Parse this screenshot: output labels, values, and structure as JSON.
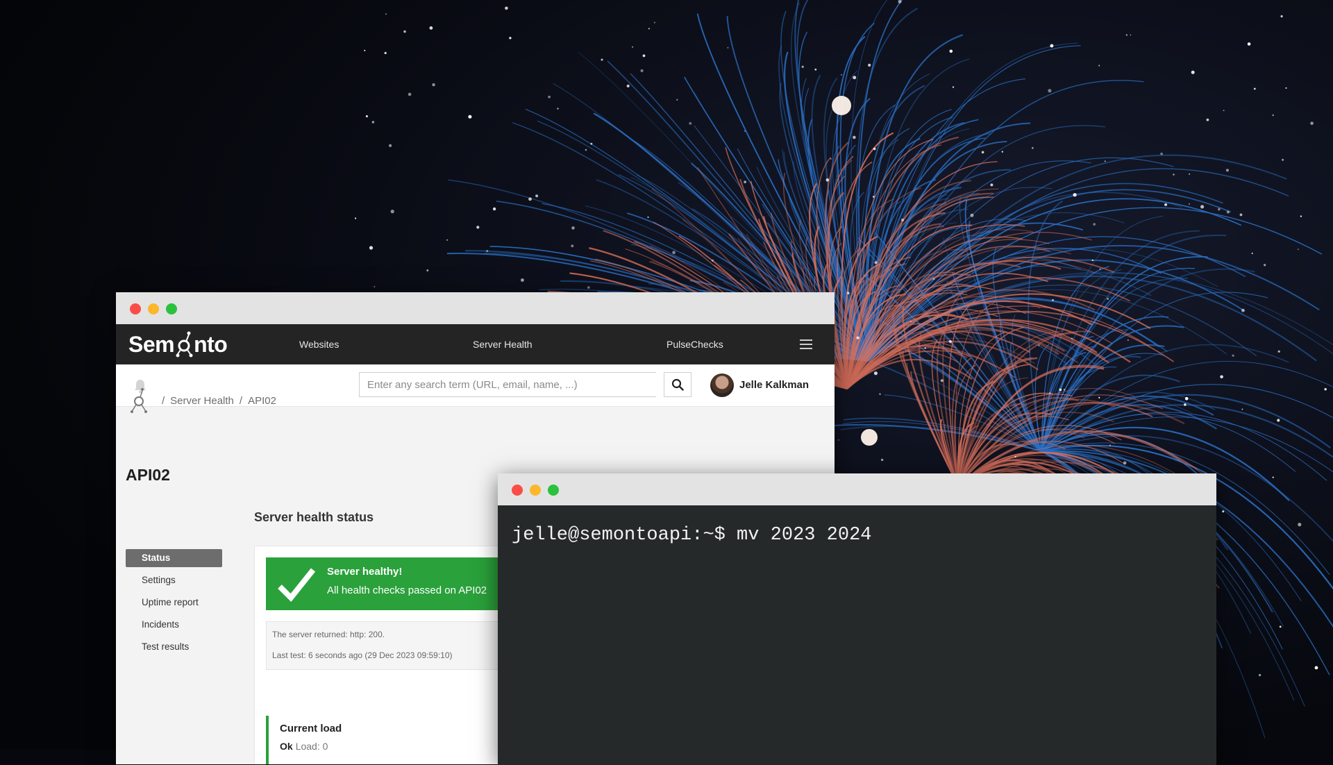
{
  "colors": {
    "accent_green": "#2aa13b",
    "navbar_bg": "#242424",
    "terminal_bg": "#262929",
    "traffic_red": "#fc4c48",
    "traffic_yellow": "#fcb72c",
    "traffic_green": "#2ac23d"
  },
  "browser": {
    "navbar": {
      "logo_left": "Sem",
      "logo_right": "nto",
      "links": [
        "Websites",
        "Server Health",
        "PulseChecks"
      ]
    },
    "search": {
      "placeholder": "Enter any search term (URL, email, name, ...)"
    },
    "user": {
      "name": "Jelle Kalkman"
    },
    "breadcrumb": {
      "items": [
        "Server Health",
        "API02"
      ]
    },
    "page_title": "API02",
    "section_title": "Server health status",
    "side_menu": {
      "items": [
        "Status",
        "Settings",
        "Uptime report",
        "Incidents",
        "Test results"
      ],
      "active": "Status"
    },
    "status": {
      "title": "Server healthy!",
      "description": "All health checks passed on API02",
      "returned": "The server returned: http: 200.",
      "last_test": "Last test: 6 seconds ago (29 Dec 2023 09:59:10)"
    },
    "load": {
      "title": "Current load",
      "status": "Ok",
      "value": "Load: 0"
    }
  },
  "terminal": {
    "command_line": "jelle@semontoapi:~$ mv 2023 2024"
  }
}
